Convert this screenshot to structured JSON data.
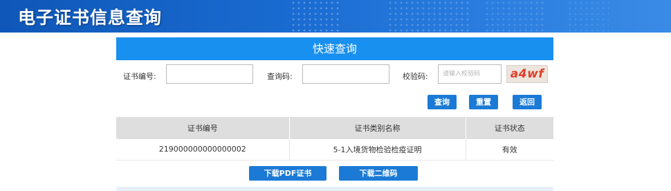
{
  "banner": {
    "title": "电子证书信息查询"
  },
  "panel": {
    "heading": "快速查询"
  },
  "form": {
    "cert_no_label": "证书编号:",
    "cert_no_value": "",
    "query_code_label": "查询码:",
    "query_code_value": "",
    "verify_label": "校验码:",
    "verify_placeholder": "请输入校验码",
    "captcha_text": "a4wf"
  },
  "actions": {
    "query": "查询",
    "reset": "重置",
    "back": "返回"
  },
  "table": {
    "headers": [
      "证书编号",
      "证书类别名称",
      "证书状态"
    ],
    "rows": [
      [
        "219000000000000002",
        "5-1入境货物检验检疫证明",
        "有效"
      ]
    ]
  },
  "downloads": {
    "pdf": "下载PDF证书",
    "qrcode": "下载二维码"
  },
  "colors": {
    "banner": "#1a6cd2",
    "panel_header": "#1890f0",
    "button": "#1b7ad6",
    "captcha_text": "#e0402a"
  }
}
